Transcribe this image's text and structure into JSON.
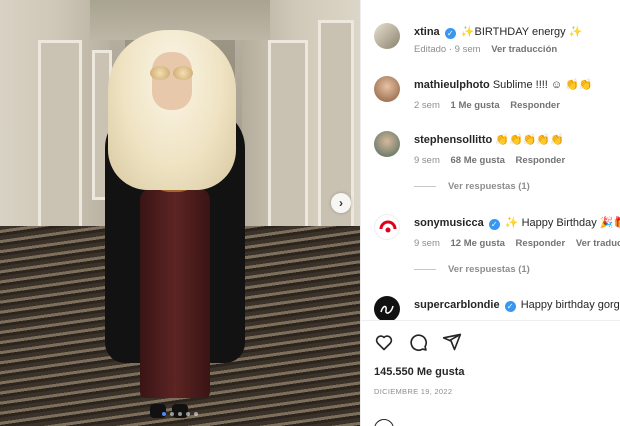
{
  "post": {
    "dots_count": 5,
    "active_dot": 0
  },
  "caption": {
    "username": "xtina",
    "text": "✨BIRTHDAY energy ✨",
    "meta_time": "Editado · 9 sem",
    "meta_action": "Ver traducción"
  },
  "comments": [
    {
      "username": "mathieulphoto",
      "text": "Sublime !!!! ☺ 👏👏",
      "verified": false,
      "time": "2 sem",
      "likes": "1 Me gusta",
      "reply": "Responder"
    },
    {
      "username": "stephensollitto",
      "text": "👏👏👏👏👏",
      "verified": false,
      "time": "9 sem",
      "likes": "68 Me gusta",
      "reply": "Responder",
      "view_replies": "Ver respuestas (1)"
    },
    {
      "username": "sonymusicca",
      "text": "✨ Happy Birthday 🎉🎁",
      "verified": true,
      "time": "9 sem",
      "likes": "12 Me gusta",
      "reply": "Responder",
      "translate": "Ver traducción",
      "view_replies": "Ver respuestas (1)"
    },
    {
      "username": "supercarblondie",
      "text": "Happy birthday gorgeous",
      "verified": true
    }
  ],
  "actions": {
    "like_icon": "heart-icon",
    "comment_icon": "comment-icon",
    "share_icon": "share-icon"
  },
  "likes": "145.550 Me gusta",
  "date": "DICIEMBRE 19, 2022",
  "colors": {
    "verified": "#3897f0",
    "muted": "#8e8e8e",
    "active_dot": "#4a8df6"
  }
}
